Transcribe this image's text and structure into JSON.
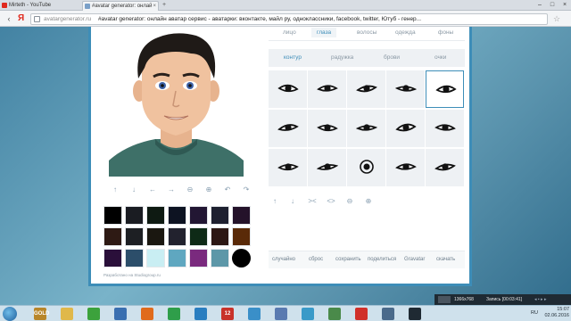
{
  "browser": {
    "tabs": [
      {
        "title": "Mirteth - YouTube",
        "active": false
      },
      {
        "title": "#avatar generator: онлай",
        "active": true
      }
    ],
    "address": {
      "logo": "Я",
      "host": "avatargenerator.ru",
      "title": "#avatar generator: онлайн аватар сервис - аватарки: вконтакте, майл ру, одноклассники, facebook, twitter, Ютуб - генер..."
    }
  },
  "editor": {
    "main_tabs": [
      "лицо",
      "глаза",
      "волосы",
      "одежда",
      "фоны"
    ],
    "active_main_tab": "глаза",
    "sub_tabs": [
      "контур",
      "радужка",
      "брови",
      "очки"
    ],
    "active_sub_tab": "контур",
    "left_tools": [
      "arrow-up-icon",
      "arrow-down-icon",
      "arrow-left-icon",
      "arrow-right-icon",
      "zoom-out-icon",
      "zoom-in-icon",
      "rotate-left-icon",
      "rotate-right-icon"
    ],
    "right_tools": [
      "arrow-up-icon",
      "arrow-down-icon",
      "narrow-icon",
      "widen-icon",
      "zoom-out-icon",
      "zoom-in-icon"
    ],
    "palette": [
      [
        "#000000",
        "#1a1c22",
        "#0e1a12",
        "#0d1322",
        "#221633",
        "#1e2030",
        "#24122a"
      ],
      [
        "#2e1a14",
        "#1d1f23",
        "#1a1710",
        "#22222e",
        "#0e2a16",
        "#2c1714",
        "#5a2a08"
      ],
      [
        "#2a0f3a",
        "#2c4e6a",
        "#c9eef3",
        "#5fa7c0",
        "#7a2a7e",
        "#5d97a8",
        "#000000"
      ]
    ],
    "actions": [
      "случайно",
      "сброс",
      "сохранить",
      "поделиться",
      "Gravatar",
      "скачать"
    ],
    "credit": "Разработано на Studiogroup.ru"
  },
  "recorder": {
    "resolution": "1366x768",
    "status": "Запись [00:03:41]"
  },
  "taskbar": {
    "time": "15:07",
    "date": "02.06.2016",
    "lang": "RU",
    "items": [
      {
        "icon": "gold-icon",
        "label": "GOLD",
        "color": "#b8862a"
      },
      {
        "icon": "file-explorer-icon",
        "label": "",
        "color": "#e0b84a"
      },
      {
        "icon": "utorrent-icon",
        "label": "",
        "color": "#3ca23c"
      },
      {
        "icon": "media-icon",
        "label": "",
        "color": "#3a6fb0"
      },
      {
        "icon": "firefox-icon",
        "label": "",
        "color": "#e06b1c"
      },
      {
        "icon": "chrome-icon",
        "label": "",
        "color": "#2f9e4a"
      },
      {
        "icon": "player-icon",
        "label": "",
        "color": "#2a7ec0"
      },
      {
        "icon": "app-12-icon",
        "label": "12",
        "color": "#c8322a"
      },
      {
        "icon": "chat-icon",
        "label": "",
        "color": "#3a8fc8"
      },
      {
        "icon": "paint-icon",
        "label": "",
        "color": "#5a7ab0"
      },
      {
        "icon": "people-icon",
        "label": "",
        "color": "#3a9ac8"
      },
      {
        "icon": "stats-icon",
        "label": "",
        "color": "#4a8a4a"
      },
      {
        "icon": "yandex-browser-icon",
        "label": "",
        "color": "#d0302a"
      },
      {
        "icon": "settings-icon",
        "label": "",
        "color": "#4a6a8a"
      },
      {
        "icon": "recorder-icon",
        "label": "",
        "color": "#1f2a33"
      }
    ]
  }
}
